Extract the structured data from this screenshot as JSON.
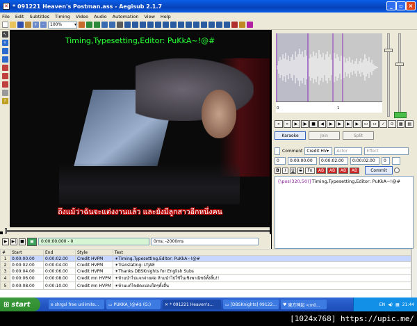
{
  "window": {
    "title": "* 091221 Heaven's Postman.ass - Aegisub 2.1.7"
  },
  "menu": [
    "File",
    "Edit",
    "Subtitles",
    "Timing",
    "Video",
    "Audio",
    "Automation",
    "View",
    "Help"
  ],
  "toolbar": {
    "zoom": "100%"
  },
  "video": {
    "sub_top": "Timing,Typesetting,Editor: PuKkA~!@#",
    "sub_bottom": "ถึงแม้ว่าฉันจะแต่งงานแล้ว และยังมีลูกสาวอีกหนึ่งคน",
    "seek_position": 0.0
  },
  "video_controls": {
    "time": "0:00:00.000 - 0",
    "offset": "0ms; -2000ms"
  },
  "audio": {
    "ruler_labels": [
      "0",
      "1"
    ]
  },
  "audio_modes": {
    "karaoke": "Karaoke",
    "join": "Join",
    "split": "Split"
  },
  "edit": {
    "comment_label": "Comment",
    "style": "Credit HV",
    "actor_placeholder": "Actor",
    "effect_placeholder": "Effect",
    "layer": "0",
    "start": "0:00:00.00",
    "end": "0:00:02.00",
    "duration": "0:00:02.00",
    "ml": "0",
    "fmt_buttons": [
      "B",
      "I",
      "U",
      "S",
      "Fn",
      "AB",
      "AB",
      "AB",
      "AB"
    ],
    "commit_label": "Commit",
    "text_tag": "{\\pos(320,50)}",
    "text_body": "Timing,Typesetting,Editor: PuKkA~!@#"
  },
  "grid": {
    "columns": [
      "#",
      "Start",
      "End",
      "Style",
      "Text"
    ],
    "rows": [
      {
        "n": "1",
        "start": "0:00:00.00",
        "end": "0:00:02.00",
        "style": "Credit HVPM",
        "text": "☀Timing,Typesetting,Editor: PuKkA~!@#"
      },
      {
        "n": "2",
        "start": "0:00:02.00",
        "end": "0:00:04.00",
        "style": "Credit HVPM",
        "text": "☀Translating: LYJAE"
      },
      {
        "n": "3",
        "start": "0:00:04.00",
        "end": "0:00:06.00",
        "style": "Credit HVPM",
        "text": "☀Thanks DBSKnights for English Subs"
      },
      {
        "n": "4",
        "start": "0:00:06.00",
        "end": "0:00:08.00",
        "style": "Credit mn HVPM",
        "text": "☀ห้ามนำไปแจกจ่ายต่อ ห้ามนำไปใช้ในเชิงพาณิชย์ทั้งสิ้น!!"
      },
      {
        "n": "5",
        "start": "0:00:08.00",
        "end": "0:00:10.00",
        "style": "Credit mn HVPM",
        "text": "☀ห้ามแก้ไขดัดแปลงใดๆทั้งสิ้น"
      }
    ]
  },
  "taskbar": {
    "start": "start",
    "tasks": [
      "shrgsl free unlimite...",
      "PUKKA_!@#$ (G:)",
      "* 091221 Heaven's...",
      "[DBSKnights] 09122...",
      "東方神起 <m0..."
    ],
    "lang": "EN",
    "clock": "21:44"
  },
  "footer": "[1024x768] https://upic.me/",
  "colors": {
    "title_blue": "#0a5ee9",
    "sub_green": "#2bff3a",
    "sub_red_outline": "#cc0000",
    "wave_purple": "#9030c0"
  }
}
